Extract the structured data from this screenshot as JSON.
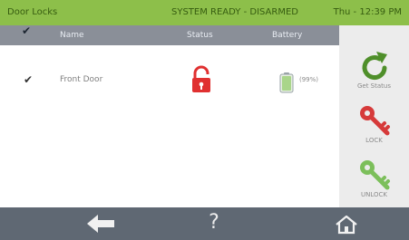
{
  "top_bar": {
    "title": "Door Locks",
    "status": "SYSTEM READY - DISARMED",
    "datetime": "Thu - 12:39 PM",
    "background": "#8dbf4a"
  },
  "table": {
    "columns": {
      "check": "✔",
      "name": "Name",
      "status": "Status",
      "battery": "Battery"
    },
    "rows": [
      {
        "checked": "✔",
        "name": "Front Door",
        "status_icon": "unlocked-padlock-icon",
        "status_color": "#e03030",
        "battery_icon": "battery-icon",
        "battery": "(99%)"
      }
    ]
  },
  "actions": {
    "get_status": {
      "label": "Get Status",
      "icon": "refresh-icon",
      "color": "#4f8f2a"
    },
    "lock": {
      "label": "LOCK",
      "icon": "key-icon",
      "color": "#d63a3a"
    },
    "unlock": {
      "label": "UNLOCK",
      "icon": "key-icon",
      "color": "#7cbf5b"
    }
  },
  "bottom_nav": {
    "back_icon": "back-arrow-icon",
    "help": "?",
    "home_icon": "home-icon"
  }
}
